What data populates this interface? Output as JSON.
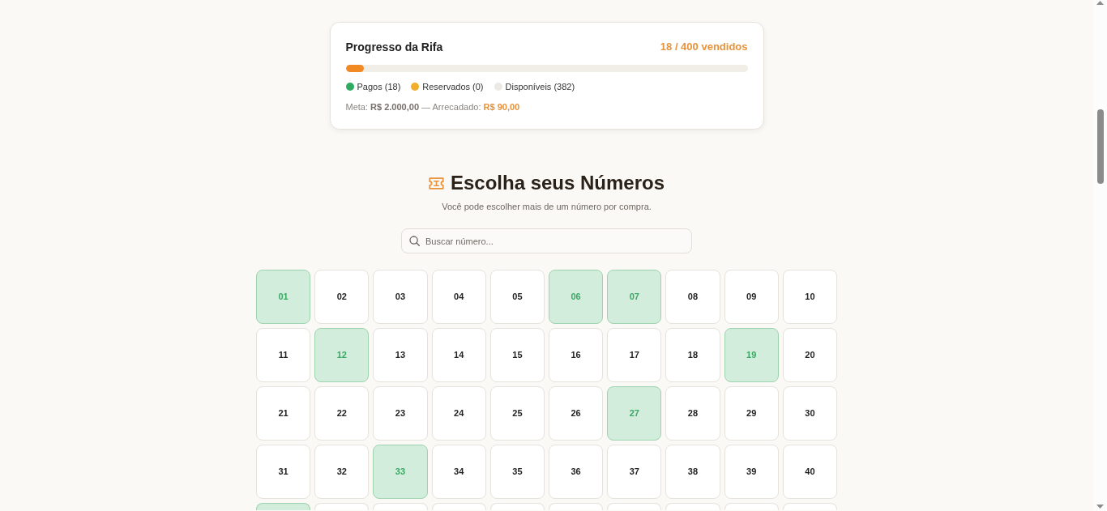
{
  "progress": {
    "title": "Progresso da Rifa",
    "sold": "18 / 400 vendidos",
    "level": 0.045,
    "legend": [
      {
        "label": "Pagos (18)",
        "color": "#2eaa62"
      },
      {
        "label": "Reservados (0)",
        "color": "#f1ae2a"
      },
      {
        "label": "Disponíveis (382)",
        "color": "#ece9e4"
      }
    ],
    "summary": {
      "goal_label": "Meta:",
      "goal_value": "R$ 2.000,00",
      "separator": "—",
      "raised_label": "Arrecadado:",
      "raised_value": "R$ 90,00"
    }
  },
  "section": {
    "title": "Escolha seus Números",
    "subtitle": "Você pode escolher mais de um número por compra."
  },
  "search": {
    "placeholder": "Buscar número..."
  },
  "numbers": [
    {
      "number": "01",
      "paid": true
    },
    {
      "number": "02",
      "paid": false
    },
    {
      "number": "03",
      "paid": false
    },
    {
      "number": "04",
      "paid": false
    },
    {
      "number": "05",
      "paid": false
    },
    {
      "number": "06",
      "paid": true
    },
    {
      "number": "07",
      "paid": true
    },
    {
      "number": "08",
      "paid": false
    },
    {
      "number": "09",
      "paid": false
    },
    {
      "number": "10",
      "paid": false
    },
    {
      "number": "11",
      "paid": false
    },
    {
      "number": "12",
      "paid": true
    },
    {
      "number": "13",
      "paid": false
    },
    {
      "number": "14",
      "paid": false
    },
    {
      "number": "15",
      "paid": false
    },
    {
      "number": "16",
      "paid": false
    },
    {
      "number": "17",
      "paid": false
    },
    {
      "number": "18",
      "paid": false
    },
    {
      "number": "19",
      "paid": true
    },
    {
      "number": "20",
      "paid": false
    },
    {
      "number": "21",
      "paid": false
    },
    {
      "number": "22",
      "paid": false
    },
    {
      "number": "23",
      "paid": false
    },
    {
      "number": "24",
      "paid": false
    },
    {
      "number": "25",
      "paid": false
    },
    {
      "number": "26",
      "paid": false
    },
    {
      "number": "27",
      "paid": true
    },
    {
      "number": "28",
      "paid": false
    },
    {
      "number": "29",
      "paid": false
    },
    {
      "number": "30",
      "paid": false
    },
    {
      "number": "31",
      "paid": false
    },
    {
      "number": "32",
      "paid": false
    },
    {
      "number": "33",
      "paid": true
    },
    {
      "number": "34",
      "paid": false
    },
    {
      "number": "35",
      "paid": false
    },
    {
      "number": "36",
      "paid": false
    },
    {
      "number": "37",
      "paid": false
    },
    {
      "number": "38",
      "paid": false
    },
    {
      "number": "39",
      "paid": false
    },
    {
      "number": "40",
      "paid": false
    },
    {
      "paid": true
    },
    {
      "paid": false
    },
    {
      "paid": false
    },
    {
      "paid": false
    },
    {
      "paid": false
    },
    {
      "paid": false
    },
    {
      "paid": false
    },
    {
      "paid": false
    },
    {
      "paid": false
    },
    {
      "paid": false
    }
  ]
}
